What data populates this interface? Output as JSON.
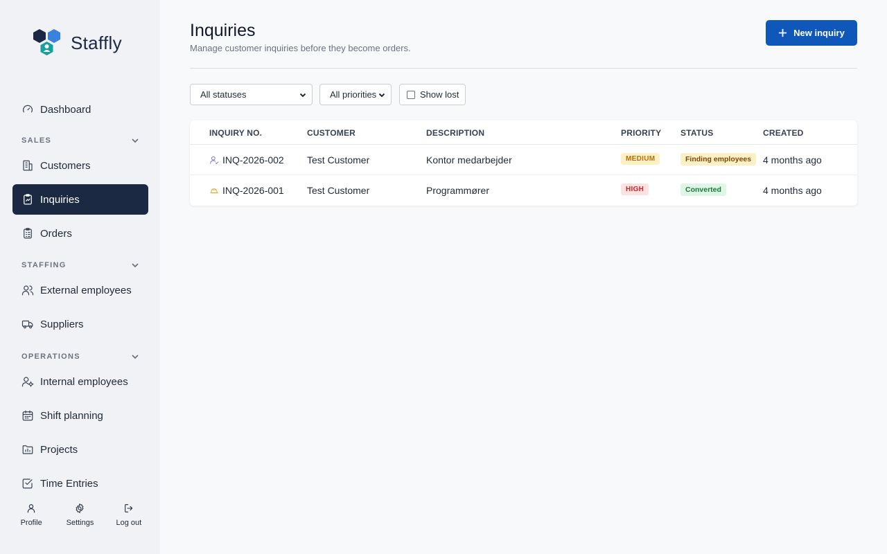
{
  "brand": {
    "name": "Staffly",
    "colors": {
      "navy": "#1b2942",
      "blue": "#3b82e0",
      "teal": "#16a0a0"
    }
  },
  "sidebar": {
    "dashboard": {
      "label": "Dashboard",
      "icon": "gauge-icon"
    },
    "sections": [
      {
        "label": "SALES",
        "items": [
          {
            "label": "Customers",
            "icon": "building-icon"
          },
          {
            "label": "Inquiries",
            "icon": "clipboard-icon",
            "active": true
          },
          {
            "label": "Orders",
            "icon": "clipboard-list-icon"
          }
        ]
      },
      {
        "label": "STAFFING",
        "items": [
          {
            "label": "External employees",
            "icon": "users-icon"
          },
          {
            "label": "Suppliers",
            "icon": "truck-icon"
          }
        ]
      },
      {
        "label": "OPERATIONS",
        "items": [
          {
            "label": "Internal employees",
            "icon": "user-cog-icon"
          },
          {
            "label": "Shift planning",
            "icon": "calendar-icon"
          },
          {
            "label": "Projects",
            "icon": "folder-chart-icon"
          },
          {
            "label": "Time Entries",
            "icon": "check-square-icon"
          }
        ]
      }
    ],
    "bottom": {
      "profile": "Profile",
      "settings": "Settings",
      "logout": "Log out"
    }
  },
  "header": {
    "title": "Inquiries",
    "subtitle": "Manage customer inquiries before they become orders.",
    "new_button": "New inquiry"
  },
  "filters": {
    "status": "All statuses",
    "priority": "All priorities",
    "show_lost": "Show lost",
    "show_lost_checked": false
  },
  "table": {
    "columns": [
      "INQUIRY NO.",
      "CUSTOMER",
      "DESCRIPTION",
      "PRIORITY",
      "STATUS",
      "CREATED"
    ],
    "rows": [
      {
        "icon": "user-icon",
        "number": "INQ-2026-002",
        "customer": "Test Customer",
        "description": "Kontor medarbejder",
        "priority": "MEDIUM",
        "status": "Finding employees",
        "created": "4 months ago"
      },
      {
        "icon": "hardhat-icon",
        "number": "INQ-2026-001",
        "customer": "Test Customer",
        "description": "Programmører",
        "priority": "HIGH",
        "status": "Converted",
        "created": "4 months ago"
      }
    ]
  }
}
